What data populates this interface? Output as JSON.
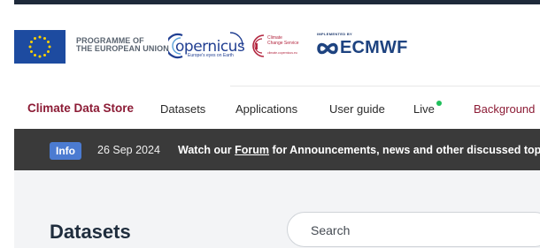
{
  "logos": {
    "programme_line1": "PROGRAMME OF",
    "programme_line2": "THE EUROPEAN UNION",
    "copernicus": "opernicus",
    "copernicus_tagline": "Europe's eyes on Earth",
    "c3s_line1": "Climate",
    "c3s_line2": "Change Service",
    "c3s_url": "climate.copernicus.eu",
    "ecmwf_implemented": "IMPLEMENTED BY",
    "ecmwf_name": "ECMWF",
    "eu_color": "#1d4ba0",
    "star_color": "#ffd200"
  },
  "nav": {
    "brand": "Climate Data Store",
    "items": [
      "Datasets",
      "Applications",
      "User guide",
      "Live",
      "Background"
    ],
    "live_status_color": "#1fbf5b"
  },
  "info": {
    "badge": "Info",
    "date": "26 Sep 2024",
    "msg_before": "Watch our",
    "msg_link": "Forum",
    "msg_after": "for Announcements, news and other discussed topics."
  },
  "main": {
    "title": "Datasets",
    "search_placeholder": "Search"
  }
}
